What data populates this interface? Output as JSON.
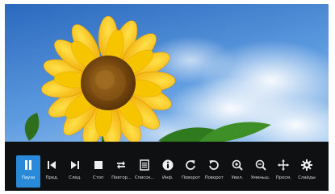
{
  "viewer": {
    "image_subject": "sunflower against blue sky"
  },
  "toolbar": {
    "active_index": 0,
    "buttons": [
      {
        "label": "Пауза",
        "icon": "pause-icon"
      },
      {
        "label": "Пред.",
        "icon": "skip-previous-icon"
      },
      {
        "label": "След.",
        "icon": "skip-next-icon"
      },
      {
        "label": "Стоп",
        "icon": "stop-icon"
      },
      {
        "label": "Повтор...",
        "icon": "repeat-icon"
      },
      {
        "label": "Список...",
        "icon": "list-icon"
      },
      {
        "label": "Инф.",
        "icon": "info-icon"
      },
      {
        "label": "Поворот",
        "icon": "rotate-right-icon"
      },
      {
        "label": "Поворот",
        "icon": "rotate-left-icon"
      },
      {
        "label": "Увел.",
        "icon": "zoom-in-icon"
      },
      {
        "label": "Уменьш.",
        "icon": "zoom-out-icon"
      },
      {
        "label": "Просм.",
        "icon": "pan-icon"
      },
      {
        "label": "Слайды",
        "icon": "settings-icon"
      }
    ]
  },
  "colors": {
    "toolbar_bg": "#0f1012",
    "active_accent": "#2a8ad9",
    "sky_top": "#2c6fc2",
    "sky_bottom": "#9fc6ee",
    "petal": "#f6c300",
    "center": "#8a5a12"
  }
}
